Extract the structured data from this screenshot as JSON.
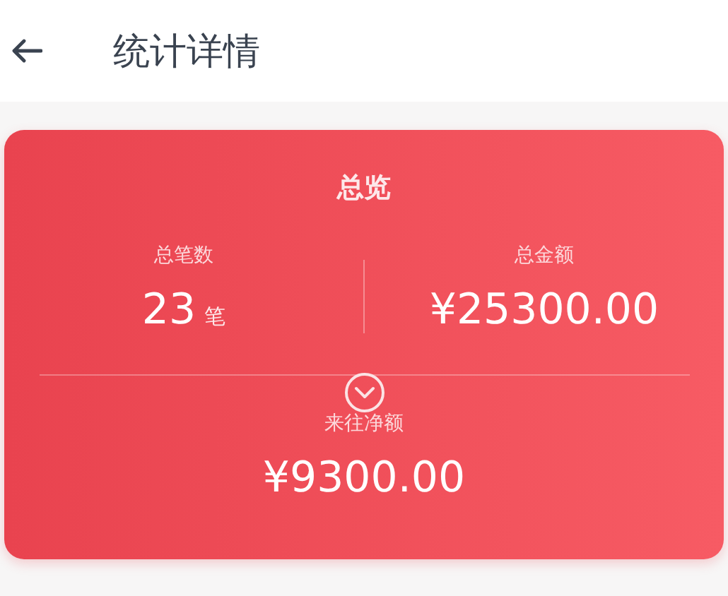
{
  "header": {
    "title": "统计详情"
  },
  "overview": {
    "title": "总览",
    "stats": [
      {
        "label": "总笔数",
        "value": "23",
        "unit": "笔"
      },
      {
        "label": "总金额",
        "value": "¥25300.00"
      }
    ],
    "net": {
      "label": "来往净额",
      "value": "¥9300.00"
    }
  }
}
